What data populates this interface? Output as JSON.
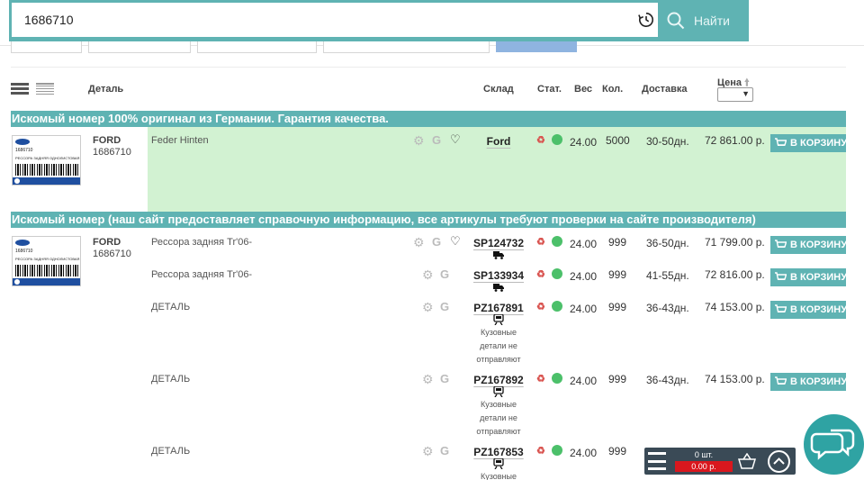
{
  "search": {
    "value": "1686710",
    "button_label": "Найти"
  },
  "columns": {
    "detail": "Деталь",
    "warehouse": "Склад",
    "status": "Стат.",
    "weight": "Вес",
    "qty": "Кол.",
    "delivery": "Доставка",
    "price": "Цена"
  },
  "sections": {
    "original": "Искомый номер 100% оригинал из Германии. Гарантия качества.",
    "analogs": "Искомый номер    (наш сайт предоставляет справочную информацию, все артикулы требуют проверки на сайте производителя)"
  },
  "original_row": {
    "brand": "FORD",
    "article": "1686710",
    "description": "Feder Hinten",
    "warehouse": "Ford",
    "weight": "24.00",
    "qty": "5000",
    "delivery": "30-50дн.",
    "price": "72 861.00 р.",
    "cart_label": "В КОРЗИНУ"
  },
  "product_image": {
    "number": "1686710",
    "caption": "РЕССОРА ЗАДНЯЯ ОДНОЛИСТОВАЯ"
  },
  "analog_block": {
    "brand": "FORD",
    "article": "1686710"
  },
  "rows": [
    {
      "description": "Рессора задняя Tr'06-",
      "warehouse": "SP124732",
      "weight": "24.00",
      "qty": "999",
      "delivery": "36-50дн.",
      "price": "71 799.00 р.",
      "cart_label": "В КОРЗИНУ",
      "note": ""
    },
    {
      "description": "Рессора задняя Tr'06-",
      "warehouse": "SP133934",
      "weight": "24.00",
      "qty": "999",
      "delivery": "41-55дн.",
      "price": "72 816.00 р.",
      "cart_label": "В КОРЗИНУ",
      "note": ""
    },
    {
      "description": "ДЕТАЛЬ",
      "warehouse": "PZ167891",
      "weight": "24.00",
      "qty": "999",
      "delivery": "36-43дн.",
      "price": "74 153.00 р.",
      "cart_label": "В КОРЗИНУ",
      "note": "Кузовные детали не отправляют"
    },
    {
      "description": "ДЕТАЛЬ",
      "warehouse": "PZ167892",
      "weight": "24.00",
      "qty": "999",
      "delivery": "36-43дн.",
      "price": "74 153.00 р.",
      "cart_label": "В КОРЗИНУ",
      "note": "Кузовные детали не отправляют"
    },
    {
      "description": "ДЕТАЛЬ",
      "warehouse": "PZ167853",
      "weight": "24.00",
      "qty": "999",
      "delivery": "",
      "price": "",
      "cart_label": "",
      "note": "Кузовные"
    }
  ],
  "mini_cart": {
    "count": "0 шт.",
    "total": "0.00 р."
  },
  "colors": {
    "accent": "#5fb3b3",
    "highlight": "#d2f2d2",
    "status_ok": "#4cc06a",
    "cart_total_bg": "#d9171e"
  }
}
